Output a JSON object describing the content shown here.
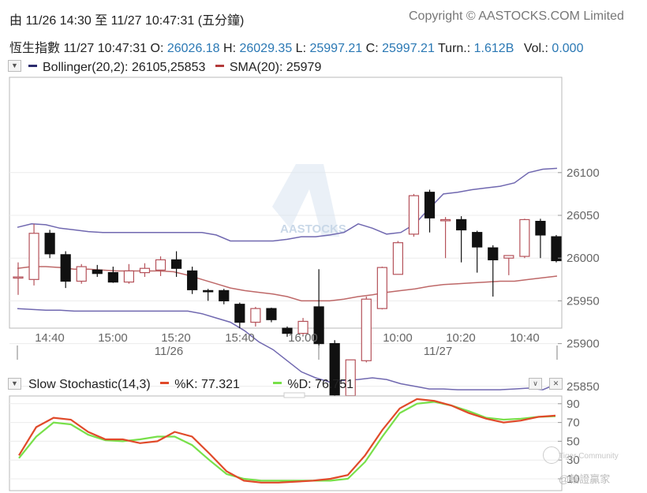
{
  "header": {
    "range_title": "由  11/26 14:30 至  11/27 10:47:31 (五分鐘)",
    "copyright": "Copyright © AASTOCKS.COM Limited"
  },
  "quote": {
    "name": "恆生指數",
    "datetime": "11/27 10:47:31",
    "open_label": "O:",
    "open": "26026.18",
    "high_label": "H:",
    "high": "26029.35",
    "low_label": "L:",
    "low": "25997.21",
    "close_label": "C:",
    "close": "25997.21",
    "turnover_label": "Turn.:",
    "turnover": "1.612B",
    "volume_label": "Vol.:",
    "volume": "0.000"
  },
  "main_legend": {
    "bollinger": "Bollinger(20,2): 26105,25853",
    "sma": "SMA(20): 25979"
  },
  "stoch_legend": {
    "title": "Slow Stochastic(14,3)",
    "k": "%K: 77.321",
    "d": "%D: 76.751"
  },
  "controls": {
    "menu_glyph": "▼",
    "dropdown_glyph": "∨",
    "close_glyph": "✕"
  },
  "watermark": {
    "text": "AASTOCKS",
    "credit_line1": "Tiger Community",
    "credit_line2": "@輪證贏家"
  },
  "colors": {
    "bollinger": "#7068b0",
    "sma": "#b34d4d",
    "up_candle": "#b5525a",
    "down_candle": "#111111",
    "stoch_k": "#e04a2a",
    "stoch_d": "#78e04a",
    "quote_value": "#2a78b4"
  },
  "chart_data": [
    {
      "type": "candlestick",
      "title": "",
      "x_ticks": [
        "14:40",
        "15:00",
        "15:20",
        "15:40",
        "16:00",
        "10:00",
        "10:20",
        "10:40"
      ],
      "date_labels": [
        "11/26",
        "11/27"
      ],
      "y_ticks": [
        25850,
        25900,
        25950,
        26000,
        26050,
        26100
      ],
      "ylim": [
        25820,
        26110
      ],
      "candles": [
        {
          "o": 25978,
          "h": 25995,
          "l": 25957,
          "c": 25978
        },
        {
          "o": 25975,
          "h": 26040,
          "l": 25968,
          "c": 26029
        },
        {
          "o": 26029,
          "h": 26033,
          "l": 26000,
          "c": 26005
        },
        {
          "o": 26004,
          "h": 26008,
          "l": 25965,
          "c": 25973
        },
        {
          "o": 25973,
          "h": 25993,
          "l": 25970,
          "c": 25990
        },
        {
          "o": 25986,
          "h": 25992,
          "l": 25978,
          "c": 25982
        },
        {
          "o": 25983,
          "h": 25990,
          "l": 25971,
          "c": 25972
        },
        {
          "o": 25972,
          "h": 25993,
          "l": 25970,
          "c": 25985
        },
        {
          "o": 25983,
          "h": 25994,
          "l": 25978,
          "c": 25988
        },
        {
          "o": 25986,
          "h": 26002,
          "l": 25979,
          "c": 25998
        },
        {
          "o": 25998,
          "h": 26008,
          "l": 25978,
          "c": 25988
        },
        {
          "o": 25985,
          "h": 25990,
          "l": 25958,
          "c": 25963
        },
        {
          "o": 25962,
          "h": 25964,
          "l": 25950,
          "c": 25961
        },
        {
          "o": 25962,
          "h": 25964,
          "l": 25946,
          "c": 25950
        },
        {
          "o": 25946,
          "h": 25948,
          "l": 25918,
          "c": 25925
        },
        {
          "o": 25925,
          "h": 25943,
          "l": 25920,
          "c": 25941
        },
        {
          "o": 25941,
          "h": 25942,
          "l": 25925,
          "c": 25928
        },
        {
          "o": 25918,
          "h": 25920,
          "l": 25908,
          "c": 25912
        },
        {
          "o": 25912,
          "h": 25930,
          "l": 25910,
          "c": 25926
        },
        {
          "o": 25943,
          "h": 25987,
          "l": 25895,
          "c": 25900
        },
        {
          "o": 25900,
          "h": 25904,
          "l": 25828,
          "c": 25840
        },
        {
          "o": 25839,
          "h": 25880,
          "l": 25824,
          "c": 25881
        },
        {
          "o": 25880,
          "h": 25955,
          "l": 25878,
          "c": 25952
        },
        {
          "o": 25941,
          "h": 25990,
          "l": 25940,
          "c": 25989
        },
        {
          "o": 25981,
          "h": 26020,
          "l": 25981,
          "c": 26018
        },
        {
          "o": 26028,
          "h": 26075,
          "l": 26025,
          "c": 26073
        },
        {
          "o": 26077,
          "h": 26080,
          "l": 26030,
          "c": 26047
        },
        {
          "o": 26045,
          "h": 26048,
          "l": 26000,
          "c": 26045
        },
        {
          "o": 26045,
          "h": 26049,
          "l": 25995,
          "c": 26033
        },
        {
          "o": 26030,
          "h": 26032,
          "l": 25983,
          "c": 26013
        },
        {
          "o": 26012,
          "h": 26015,
          "l": 25955,
          "c": 25998
        },
        {
          "o": 26000,
          "h": 26003,
          "l": 25980,
          "c": 26003
        },
        {
          "o": 26002,
          "h": 26046,
          "l": 26000,
          "c": 26045
        },
        {
          "o": 26043,
          "h": 26046,
          "l": 26000,
          "c": 26027
        },
        {
          "o": 26025,
          "h": 26027,
          "l": 25995,
          "c": 25997
        }
      ],
      "bollinger_upper": [
        26036,
        26040,
        26039,
        26035,
        26033,
        26031,
        26030,
        26030,
        26030,
        26030,
        26030,
        26030,
        26030,
        26030,
        26027,
        26020,
        26020,
        26020,
        26020,
        26022,
        26025,
        26025,
        26027,
        26030,
        26040,
        26035,
        26028,
        26030,
        26040,
        26058,
        26075,
        26077,
        26080,
        26082,
        26084,
        26088,
        26100,
        26104,
        26105
      ],
      "bollinger_lower": [
        25941,
        25940,
        25939,
        25939,
        25938,
        25938,
        25938,
        25938,
        25938,
        25938,
        25938,
        25938,
        25938,
        25935,
        25930,
        25925,
        25915,
        25902,
        25893,
        25880,
        25867,
        25860,
        25855,
        25857,
        25858,
        25860,
        25858,
        25853,
        25850,
        25847,
        25847,
        25846,
        25846,
        25846,
        25846,
        25847,
        25848,
        25846,
        25853
      ],
      "sma": [
        25988,
        25990,
        25990,
        25989,
        25987,
        25987,
        25986,
        25985,
        25985,
        25985,
        25985,
        25984,
        25980,
        25975,
        25970,
        25965,
        25962,
        25960,
        25958,
        25955,
        25950,
        25950,
        25950,
        25952,
        25955,
        25957,
        25960,
        25962,
        25964,
        25967,
        25969,
        25970,
        25971,
        25972,
        25973,
        25973,
        25975,
        25977,
        25979
      ]
    },
    {
      "type": "line",
      "title": "",
      "y_ticks": [
        10,
        30,
        50,
        70,
        90
      ],
      "ylim": [
        0,
        100
      ],
      "series": [
        {
          "name": "%K",
          "values": [
            35,
            65,
            75,
            73,
            60,
            52,
            52,
            48,
            50,
            60,
            55,
            37,
            18,
            8,
            6,
            6,
            7,
            8,
            10,
            14,
            35,
            62,
            85,
            95,
            93,
            88,
            80,
            74,
            70,
            72,
            76,
            77.321
          ]
        },
        {
          "name": "%D",
          "values": [
            32,
            55,
            70,
            68,
            57,
            51,
            50,
            52,
            55,
            55,
            46,
            30,
            15,
            10,
            8,
            8,
            8,
            8,
            8,
            10,
            28,
            55,
            80,
            90,
            92,
            88,
            82,
            75,
            73,
            74,
            76,
            76.751
          ]
        }
      ]
    }
  ]
}
